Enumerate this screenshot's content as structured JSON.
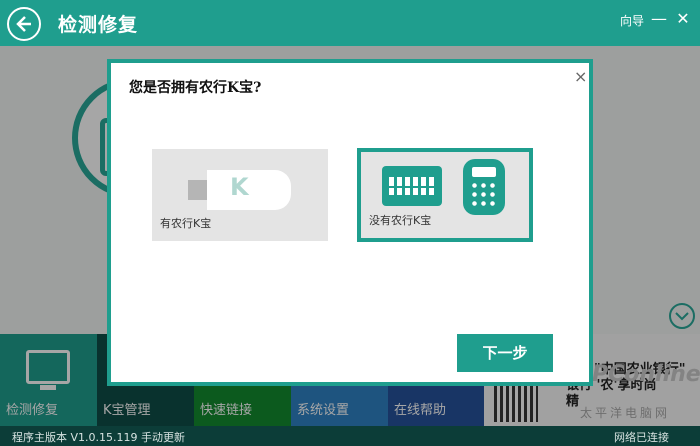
{
  "window": {
    "title": "检测修复",
    "guide_label": "向导",
    "minimize_label": "—",
    "close_label": "✕"
  },
  "nav": {
    "items": [
      {
        "label": "检测修复"
      },
      {
        "label": "K宝管理"
      },
      {
        "label": "快速链接"
      },
      {
        "label": "系统设置"
      },
      {
        "label": "在线帮助"
      }
    ]
  },
  "ad": {
    "line1": "\"中国农业银行\"",
    "line2": "银行 '农'享时尚",
    "line3": "精",
    "watermark": "PConline",
    "watermark_sub": "太平洋电脑网"
  },
  "status": {
    "version": "程序主版本 V1.0.15.119 手动更新",
    "network": "网络已连接"
  },
  "modal": {
    "question": "您是否拥有农行K宝?",
    "close_label": "×",
    "option_have": {
      "label": "有农行K宝",
      "icon_letter": "K"
    },
    "option_none": {
      "label": "没有农行K宝"
    },
    "next_label": "下一步"
  },
  "colors": {
    "accent": "#1f9e8e",
    "nav_kbao": "#0f4d47",
    "nav_quick": "#138a2e",
    "nav_system": "#2f82c4",
    "nav_help": "#26529b"
  }
}
